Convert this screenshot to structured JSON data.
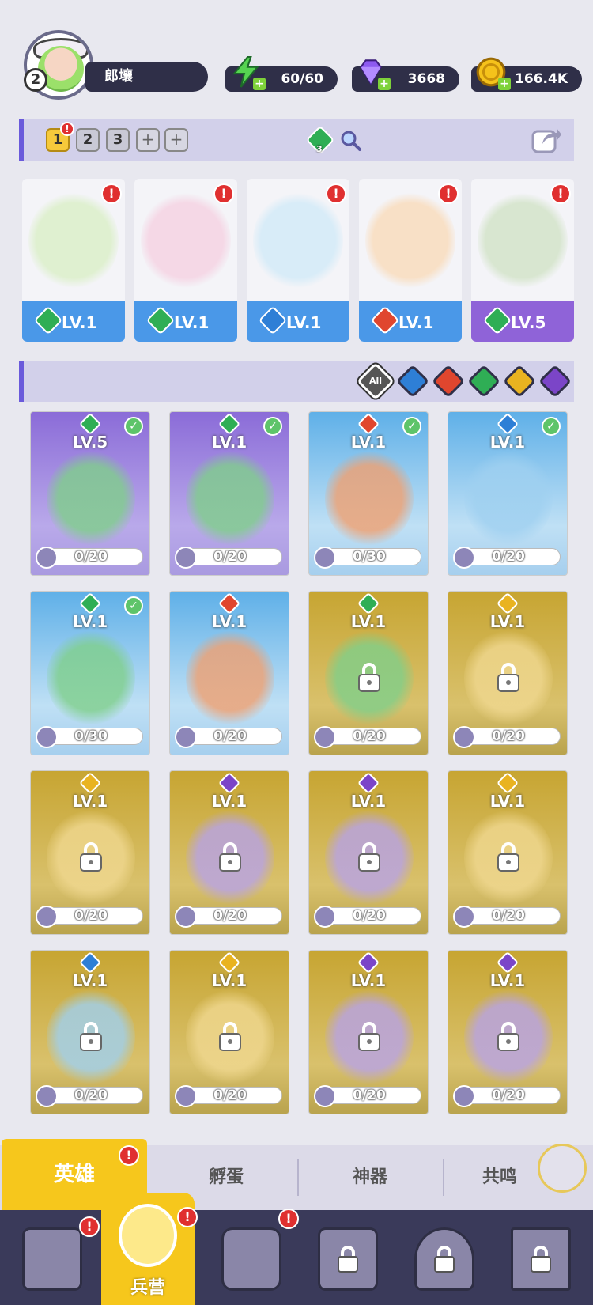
{
  "player": {
    "level": "2",
    "name": "郎壤"
  },
  "resources": {
    "energy": "60/60",
    "gems": "3668",
    "gold": "166.4K"
  },
  "team_bar": {
    "slots": [
      "1",
      "2",
      "3"
    ],
    "active_slot": "1",
    "alert": "!",
    "plus_1": "+",
    "plus_2": "+",
    "badge_count": "3"
  },
  "team": [
    {
      "element": "green",
      "level": "LV.1",
      "alert": "!",
      "footer": "blue"
    },
    {
      "element": "green",
      "level": "LV.1",
      "alert": "!",
      "footer": "blue"
    },
    {
      "element": "blue",
      "level": "LV.1",
      "alert": "!",
      "footer": "blue"
    },
    {
      "element": "red",
      "level": "LV.1",
      "alert": "!",
      "footer": "blue"
    },
    {
      "element": "green",
      "level": "LV.5",
      "alert": "!",
      "footer": "purple"
    }
  ],
  "filter": {
    "all_label": "All",
    "elements": [
      "blue",
      "red",
      "green",
      "yellow",
      "purple"
    ]
  },
  "heroes": [
    {
      "element": "green",
      "level": "LV.5",
      "progress": "0/20",
      "rarity": "purple",
      "owned": true,
      "check": "✓"
    },
    {
      "element": "green",
      "level": "LV.1",
      "progress": "0/20",
      "rarity": "purple",
      "owned": true,
      "check": "✓"
    },
    {
      "element": "red",
      "level": "LV.1",
      "progress": "0/30",
      "rarity": "blue",
      "owned": true,
      "check": "✓"
    },
    {
      "element": "blue",
      "level": "LV.1",
      "progress": "0/20",
      "rarity": "blue",
      "owned": true,
      "check": "✓"
    },
    {
      "element": "green",
      "level": "LV.1",
      "progress": "0/30",
      "rarity": "blue",
      "owned": true,
      "check": "✓"
    },
    {
      "element": "red",
      "level": "LV.1",
      "progress": "0/20",
      "rarity": "blue",
      "owned": true,
      "check": ""
    },
    {
      "element": "green",
      "level": "LV.1",
      "progress": "0/20",
      "rarity": "gold",
      "owned": false,
      "check": ""
    },
    {
      "element": "yellow",
      "level": "LV.1",
      "progress": "0/20",
      "rarity": "gold",
      "owned": false,
      "check": ""
    },
    {
      "element": "yellow",
      "level": "LV.1",
      "progress": "0/20",
      "rarity": "gold",
      "owned": false,
      "check": ""
    },
    {
      "element": "purple",
      "level": "LV.1",
      "progress": "0/20",
      "rarity": "gold",
      "owned": false,
      "check": ""
    },
    {
      "element": "purple",
      "level": "LV.1",
      "progress": "0/20",
      "rarity": "gold",
      "owned": false,
      "check": ""
    },
    {
      "element": "yellow",
      "level": "LV.1",
      "progress": "0/20",
      "rarity": "gold",
      "owned": false,
      "check": ""
    },
    {
      "element": "blue",
      "level": "LV.1",
      "progress": "0/20",
      "rarity": "gold",
      "owned": false,
      "check": ""
    },
    {
      "element": "yellow",
      "level": "LV.1",
      "progress": "0/20",
      "rarity": "gold",
      "owned": false,
      "check": ""
    },
    {
      "element": "purple",
      "level": "LV.1",
      "progress": "0/20",
      "rarity": "gold",
      "owned": false,
      "check": ""
    },
    {
      "element": "purple",
      "level": "LV.1",
      "progress": "0/20",
      "rarity": "gold",
      "owned": false,
      "check": ""
    }
  ],
  "tabs": {
    "heroes": "英雄",
    "eggs": "孵蛋",
    "artifacts": "神器",
    "resonance": "共鸣",
    "alert": "!"
  },
  "bottom_nav": {
    "barracks": "兵营",
    "alert": "!"
  },
  "colors": {
    "green": "#2fae55",
    "blue": "#2e7fd6",
    "red": "#e0462e",
    "yellow": "#e9b320",
    "purple": "#7b45c8",
    "accent_gold": "#f6c71c",
    "bar_lilac": "#d2d0ea",
    "nav_dark": "#3a3a5a"
  },
  "icons": {
    "energy": "lightning-icon",
    "gems": "diamond-icon",
    "gold": "coin-icon",
    "share": "share-icon",
    "search": "magnifier-icon",
    "lock": "lock-icon",
    "check": "check-icon"
  }
}
